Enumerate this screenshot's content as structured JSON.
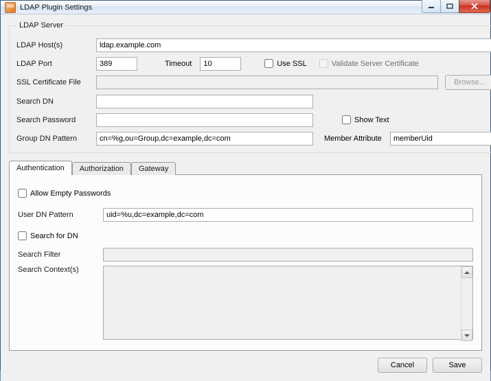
{
  "window": {
    "title": "LDAP Plugin Settings"
  },
  "server": {
    "legend": "LDAP Server",
    "host_label": "LDAP Host(s)",
    "host_value": "ldap.example.com",
    "port_label": "LDAP Port",
    "port_value": "389",
    "timeout_label": "Timeout",
    "timeout_value": "10",
    "use_ssl_label": "Use SSL",
    "validate_cert_label": "Validate Server Certificate",
    "ssl_cert_label": "SSL Certificate File",
    "ssl_cert_value": "",
    "browse_label": "Browse...",
    "search_dn_label": "Search DN",
    "search_dn_value": "",
    "search_pw_label": "Search Password",
    "search_pw_value": "",
    "show_text_label": "Show Text",
    "group_dn_label": "Group DN Pattern",
    "group_dn_value": "cn=%g,ou=Group,dc=example,dc=com",
    "member_attr_label": "Member Attribute",
    "member_attr_value": "memberUid"
  },
  "tabs": {
    "authentication": "Authentication",
    "authorization": "Authorization",
    "gateway": "Gateway"
  },
  "auth": {
    "allow_empty_label": "Allow Empty Passwords",
    "user_dn_label": "User DN Pattern",
    "user_dn_value": "uid=%u,dc=example,dc=com",
    "search_for_dn_label": "Search for DN",
    "search_filter_label": "Search Filter",
    "search_filter_value": "",
    "search_contexts_label": "Search Context(s)",
    "search_contexts_value": ""
  },
  "footer": {
    "cancel": "Cancel",
    "save": "Save"
  }
}
